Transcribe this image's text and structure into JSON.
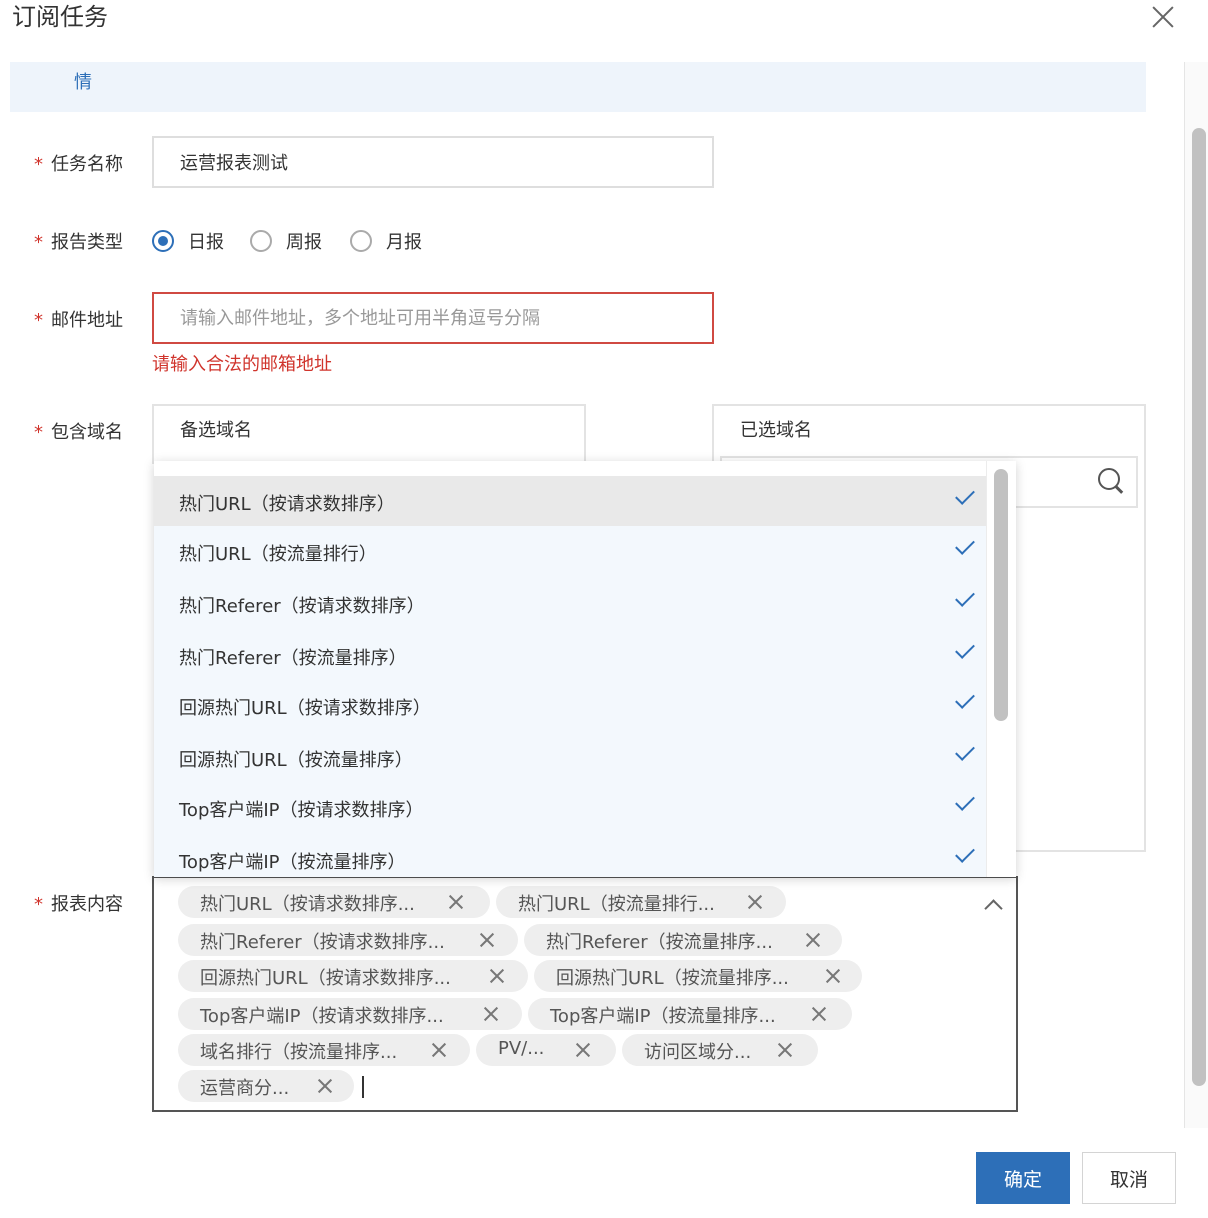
{
  "dialog": {
    "title": "订阅任务",
    "notice_text": "情"
  },
  "form": {
    "task_name": {
      "label": "任务名称",
      "value": "运营报表测试"
    },
    "report_type": {
      "label": "报告类型",
      "options": [
        "日报",
        "周报",
        "月报"
      ],
      "selected": "日报"
    },
    "email": {
      "label": "邮件地址",
      "value": "",
      "placeholder": "请输入邮件地址，多个地址可用半角逗号分隔",
      "error": "请输入合法的邮箱地址"
    },
    "domains": {
      "label": "包含域名",
      "available_title": "备选域名",
      "selected_title": "已选域名"
    },
    "content": {
      "label": "报表内容",
      "dropdown_options": [
        "热门URL（按请求数排序）",
        "热门URL（按流量排行）",
        "热门Referer（按请求数排序）",
        "热门Referer（按流量排序）",
        "回源热门URL（按请求数排序）",
        "回源热门URL（按流量排序）",
        "Top客户端IP（按请求数排序）",
        "Top客户端IP（按流量排序）"
      ],
      "tags": [
        "热门URL（按请求数排序...",
        "热门URL（按流量排行...",
        "热门Referer（按请求数排序...",
        "热门Referer（按流量排序...",
        "回源热门URL（按请求数排序...",
        "回源热门URL（按流量排序...",
        "Top客户端IP（按请求数排序...",
        "Top客户端IP（按流量排序...",
        "域名排行（按流量排序...",
        "PV/...",
        "访问区域分...",
        "运营商分..."
      ]
    },
    "required_mark": "*"
  },
  "footer": {
    "confirm_label": "确定",
    "cancel_label": "取消"
  },
  "colors": {
    "primary": "#2d6fb8",
    "error": "#d0342c",
    "notice_bg": "#eef4fb"
  },
  "icons": [
    "close-icon",
    "check-icon",
    "search-icon",
    "chevron-up-icon",
    "tag-close-icon"
  ]
}
